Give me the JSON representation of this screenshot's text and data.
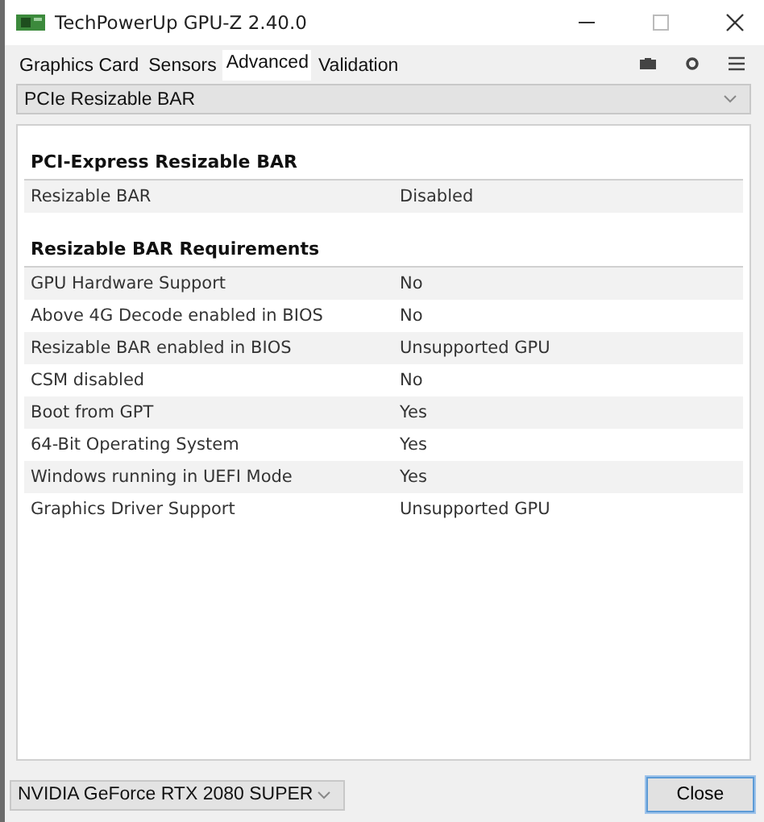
{
  "window": {
    "title": "TechPowerUp GPU-Z 2.40.0"
  },
  "tabs": [
    {
      "label": "Graphics Card",
      "selected": false
    },
    {
      "label": "Sensors",
      "selected": false
    },
    {
      "label": "Advanced",
      "selected": true
    },
    {
      "label": "Validation",
      "selected": false
    }
  ],
  "section_select": {
    "value": "PCIe Resizable BAR"
  },
  "sections": [
    {
      "title": "PCI-Express Resizable BAR",
      "rows": [
        {
          "label": "Resizable BAR",
          "value": "Disabled"
        }
      ]
    },
    {
      "title": "Resizable BAR Requirements",
      "rows": [
        {
          "label": "GPU Hardware Support",
          "value": "No"
        },
        {
          "label": "Above 4G Decode enabled in BIOS",
          "value": "No"
        },
        {
          "label": "Resizable BAR enabled in BIOS",
          "value": "Unsupported GPU"
        },
        {
          "label": "CSM disabled",
          "value": "No"
        },
        {
          "label": "Boot from GPT",
          "value": "Yes"
        },
        {
          "label": "64-Bit Operating System",
          "value": "Yes"
        },
        {
          "label": "Windows running in UEFI Mode",
          "value": "Yes"
        },
        {
          "label": "Graphics Driver Support",
          "value": "Unsupported GPU"
        }
      ]
    }
  ],
  "gpu_select": {
    "value": "NVIDIA GeForce RTX 2080 SUPER"
  },
  "buttons": [
    "Close"
  ]
}
